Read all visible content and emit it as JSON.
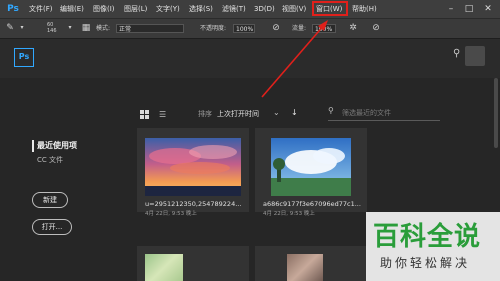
{
  "menubar": {
    "logo": "Ps",
    "items": [
      "文件(F)",
      "编辑(E)",
      "图像(I)",
      "图层(L)",
      "文字(Y)",
      "选择(S)",
      "滤镜(T)",
      "3D(D)",
      "视图(V)",
      "窗口(W)",
      "帮助(H)"
    ],
    "highlighted": "窗口(W)",
    "window_controls": [
      "–",
      "□",
      "✕"
    ]
  },
  "options": {
    "brush_size": "60",
    "brush_num": "146",
    "mode_label": "模式:",
    "mode_value": "正常",
    "opacity_label": "不透明度:",
    "opacity_value": "100%",
    "flow_label": "流量:",
    "flow_value": "100%"
  },
  "start": {
    "badge": "Ps",
    "sidebar": {
      "recent": "最近使用项",
      "cc_files": "CC 文件",
      "new_button": "新建",
      "open_button": "打开..."
    },
    "sort": {
      "label": "排序",
      "value": "上次打开时间",
      "filter_placeholder": "筛选最近的文件"
    },
    "files": [
      {
        "name": "u=2951212350,254789224...",
        "meta": "4月 22日, 9:53 晚上"
      },
      {
        "name": "a686c9177f3e67096ed77c1...",
        "meta": "4月 22日, 9:53 晚上"
      },
      {
        "name": "",
        "meta": ""
      },
      {
        "name": "",
        "meta": ""
      }
    ]
  },
  "watermark": {
    "main": "百科全说",
    "sub": "助你轻松解决"
  },
  "colors": {
    "accent": "#31a8ff",
    "highlight_red": "#e0201b",
    "watermark_green": "#2a9d3a"
  }
}
